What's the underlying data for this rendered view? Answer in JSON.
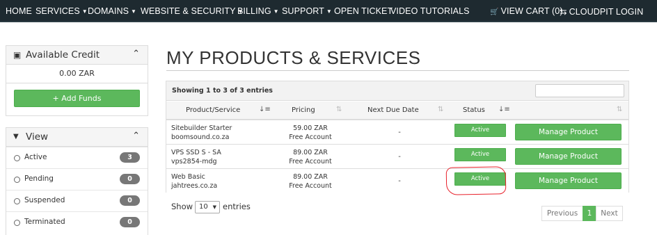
{
  "nav": {
    "home": "HOME",
    "services": "SERVICES",
    "domains": "DOMAINS",
    "website_security": "WEBSITE & SECURITY",
    "billing": "BILLING",
    "support": "SUPPORT",
    "open_ticket": "OPEN TICKET",
    "video_tutorials": "VIDEO TUTORIALS",
    "view_cart": "VIEW CART (0)",
    "login": "CLOUDPIT LOGIN",
    "caret": "▼",
    "cart_icon": "🛒",
    "login_icon": "⇆"
  },
  "sidebar": {
    "credit": {
      "title": "Available Credit",
      "icon": "▣",
      "collapse_icon": "⌃",
      "value": "0.00 ZAR",
      "add_funds": "+ Add Funds"
    },
    "view": {
      "title": "View",
      "icon": "▼",
      "collapse_icon": "⌃",
      "items": [
        {
          "label": "Active",
          "count": "3"
        },
        {
          "label": "Pending",
          "count": "0"
        },
        {
          "label": "Suspended",
          "count": "0"
        },
        {
          "label": "Terminated",
          "count": "0"
        }
      ]
    }
  },
  "main": {
    "title": "MY PRODUCTS & SERVICES",
    "showing": "Showing 1 to 3 of 3 entries",
    "search_placeholder": "",
    "columns": {
      "product": "Product/Service",
      "pricing": "Pricing",
      "next_due": "Next Due Date",
      "status": "Status"
    },
    "sort_icons": {
      "active": "↓≡",
      "inactive": "⇅"
    },
    "rows": [
      {
        "product": "Sitebuilder Starter",
        "domain": "boomsound.co.za",
        "price": "59.00 ZAR",
        "cycle": "Free Account",
        "due": "-",
        "status": "Active",
        "action": "Manage Product"
      },
      {
        "product": "VPS SSD S - SA",
        "domain": "vps2854-mdg",
        "price": "89.00 ZAR",
        "cycle": "Free Account",
        "due": "-",
        "status": "Active",
        "action": "Manage Product"
      },
      {
        "product": "Web Basic",
        "domain": "jahtrees.co.za",
        "price": "89.00 ZAR",
        "cycle": "Free Account",
        "due": "-",
        "status": "Active",
        "action": "Manage Product"
      }
    ],
    "length": {
      "show": "Show",
      "value": "10",
      "entries": "entries"
    },
    "pagination": {
      "previous": "Previous",
      "current": "1",
      "next": "Next"
    }
  },
  "colors": {
    "nav_bg": "#1e2a30",
    "success": "#5cb85c",
    "badge": "#777777",
    "annotation": "#e8202a"
  }
}
